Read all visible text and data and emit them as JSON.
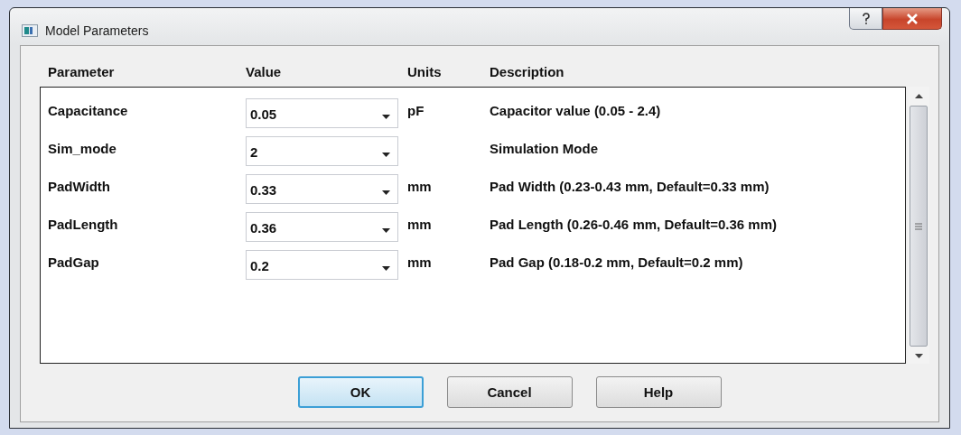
{
  "window": {
    "title": "Model Parameters"
  },
  "columns": [
    "Parameter",
    "Value",
    "Units",
    "Description"
  ],
  "rows": [
    {
      "parameter": "Capacitance",
      "value": "0.05",
      "units": "pF",
      "description": "Capacitor value (0.05 - 2.4)"
    },
    {
      "parameter": "Sim_mode",
      "value": "2",
      "description": "Simulation Mode"
    },
    {
      "parameter": "PadWidth",
      "value": "0.33",
      "units": "mm",
      "description": "Pad Width (0.23-0.43 mm, Default=0.33 mm)"
    },
    {
      "parameter": "PadLength",
      "value": "0.36",
      "units": "mm",
      "description": "Pad Length (0.26-0.46 mm, Default=0.36 mm)"
    },
    {
      "parameter": "PadGap",
      "value": "0.2",
      "units": "mm",
      "description": "Pad Gap (0.18-0.2 mm, Default=0.2 mm)"
    }
  ],
  "buttons": [
    {
      "label": "OK",
      "default": true
    },
    {
      "label": "Cancel",
      "default": false
    },
    {
      "label": "Help",
      "default": false
    }
  ]
}
